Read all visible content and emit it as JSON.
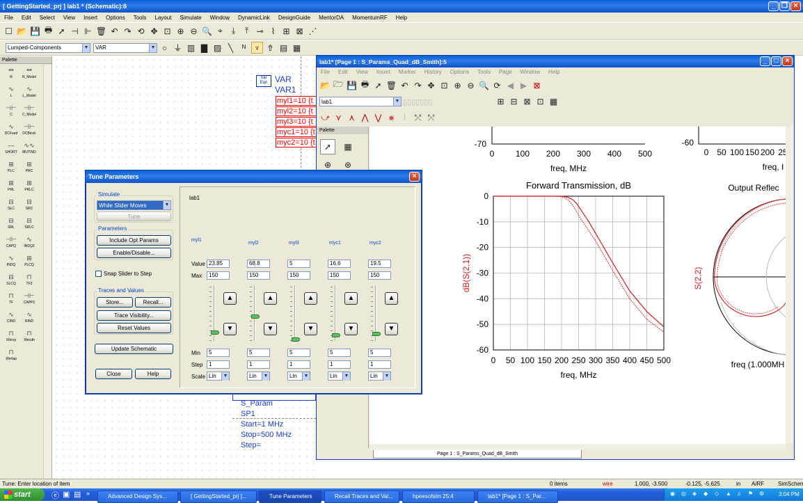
{
  "main_window": {
    "title": "[ GettingStarted_prj ] lab1 * (Schematic):8",
    "menus": [
      "File",
      "Edit",
      "Select",
      "View",
      "Insert",
      "Options",
      "Tools",
      "Layout",
      "Simulate",
      "Window",
      "DynamicLink",
      "DesignGuide",
      "MentorDA",
      "MomentumRF",
      "Help"
    ],
    "library_select": "Lumped-Components",
    "component_select": "VAR",
    "palette_title": "Palette",
    "palette_items": [
      "R",
      "R_Model",
      "L",
      "L_Model",
      "C",
      "C_Model",
      "DCFeed",
      "DCBlock",
      "SHORT",
      "MUTIND",
      "PLC",
      "PRC",
      "PRL",
      "PRLC",
      "SLC",
      "SRC",
      "SRL",
      "SRLC",
      "CAPQ",
      "INDQ2",
      "INDQ",
      "PLCQ",
      "SLCQ",
      "TF3",
      "TF",
      "CAPP2",
      "CIND",
      "RIND",
      "Xfercp",
      "Xferuth",
      "Xfertap"
    ],
    "var_block": {
      "badge": "Var Eqn",
      "name1": "VAR",
      "name2": "VAR1",
      "lines": [
        "myl1=10 {t",
        "myl2=10 {t",
        "myl3=10 {t",
        "myc1=10 {t",
        "myc2=10 {t"
      ]
    },
    "sparam_block": {
      "lines": [
        "S_Param",
        "SP1",
        "Start=1 MHz",
        "Stop=500 MHz",
        "Step="
      ]
    },
    "status_left": "Tune: Enter location of item",
    "status_items": "0 items",
    "status_layer": "wire",
    "status_coord1": "1.000, -3.500",
    "status_coord2": "-0.125, -5.625",
    "status_unit": "in",
    "status_mode": "A/RF",
    "status_app": "SimSchem"
  },
  "data_window": {
    "title": "lab1* [Page 1 : S_Params_Quad_dB_Smith]:5",
    "menus": [
      "File",
      "Edit",
      "View",
      "Insert",
      "Marker",
      "History",
      "Options",
      "Tools",
      "Page",
      "Window",
      "Help"
    ],
    "dataset_select": "lab1",
    "palette_title": "Palette",
    "page_tab": "Page 1 : S_Params_Quad_dB_Smith",
    "top_left_ytick": "-70",
    "top_left_xticks": [
      "0",
      "100",
      "200",
      "300",
      "400",
      "500"
    ],
    "top_left_xlabel": "freq, MHz",
    "top_right_ytick": "-60",
    "top_right_xticks": [
      "0",
      "50",
      "100",
      "150",
      "200",
      "25"
    ],
    "top_right_xlabel": "freq, I",
    "output_title": "Output Reflec",
    "output_ylabel": "S(2,2)",
    "output_footer": "freq (1.000MH"
  },
  "chart_data": {
    "type": "line",
    "title": "Forward Transmission, dB",
    "xlabel": "freq, MHz",
    "ylabel": "dB(S(2,1))",
    "xlim": [
      0,
      500
    ],
    "ylim": [
      -60,
      0
    ],
    "xticks": [
      0,
      50,
      100,
      150,
      200,
      250,
      300,
      350,
      400,
      450,
      500
    ],
    "yticks": [
      0,
      -10,
      -20,
      -30,
      -40,
      -50,
      -60
    ],
    "grid": true,
    "series": [
      {
        "x": [
          0,
          100,
          150,
          180,
          200,
          215,
          225,
          235,
          245,
          260,
          280,
          300,
          350,
          400,
          450,
          500
        ],
        "y": [
          0,
          0,
          0,
          0,
          0,
          -0.3,
          -0.8,
          -1.6,
          -3,
          -6,
          -10,
          -14.5,
          -26,
          -37,
          -45,
          -51
        ],
        "color": "#cc2020",
        "style": "solid"
      },
      {
        "x": [
          0,
          100,
          150,
          180,
          200,
          210,
          220,
          230,
          240,
          255,
          275,
          300,
          350,
          400,
          450,
          500
        ],
        "y": [
          0,
          0,
          0,
          0,
          -0.2,
          -0.7,
          -1.6,
          -3,
          -5,
          -8.5,
          -12.5,
          -17.5,
          -29,
          -40,
          -48,
          -53
        ],
        "color": "#cc2020",
        "style": "dotted"
      }
    ]
  },
  "tune_dialog": {
    "title": "Tune Parameters",
    "simulate_label": "Simulate",
    "simulate_mode": "While Slider Moves",
    "tune_button": "Tune",
    "parameters_label": "Parameters",
    "include_opt": "Include Opt Params",
    "enable_disable": "Enable/Disable...",
    "snap_label": "Snap Slider to Step",
    "traces_label": "Traces and Values",
    "store": "Store...",
    "recall": "Recall...",
    "trace_visibility": "Trace Visibility...",
    "reset_values": "Reset Values",
    "update_schematic": "Update Schematic",
    "close": "Close",
    "help": "Help",
    "design_name": "lab1",
    "value_label": "Value",
    "max_label": "Max",
    "min_label": "Min",
    "step_label": "Step",
    "scale_label": "Scale",
    "params": [
      {
        "name": "myl1",
        "value": "23.85",
        "max": "150",
        "min": "5",
        "step": "1",
        "scale": "Lin",
        "level": 0.13
      },
      {
        "name": "myl2",
        "value": "68.8",
        "max": "150",
        "min": "5",
        "step": "1",
        "scale": "Lin",
        "level": 0.44
      },
      {
        "name": "myl3",
        "value": "5",
        "max": "150",
        "min": "5",
        "step": "1",
        "scale": "Lin",
        "level": 0.0
      },
      {
        "name": "myc1",
        "value": "16.6",
        "max": "150",
        "min": "5",
        "step": "1",
        "scale": "Lin",
        "level": 0.08
      },
      {
        "name": "myc2",
        "value": "19.5",
        "max": "150",
        "min": "5",
        "step": "1",
        "scale": "Lin",
        "level": 0.1
      }
    ]
  },
  "taskbar": {
    "start": "start",
    "tasks": [
      "Advanced Design Sys...",
      "[ GettingStarted_prj ]...",
      "Tune Parameters",
      "Recall Traces and Val...",
      "hpeesofsim 25:4",
      "lab1* [Page 1 : S_Par..."
    ],
    "clock": "3:04 PM"
  }
}
